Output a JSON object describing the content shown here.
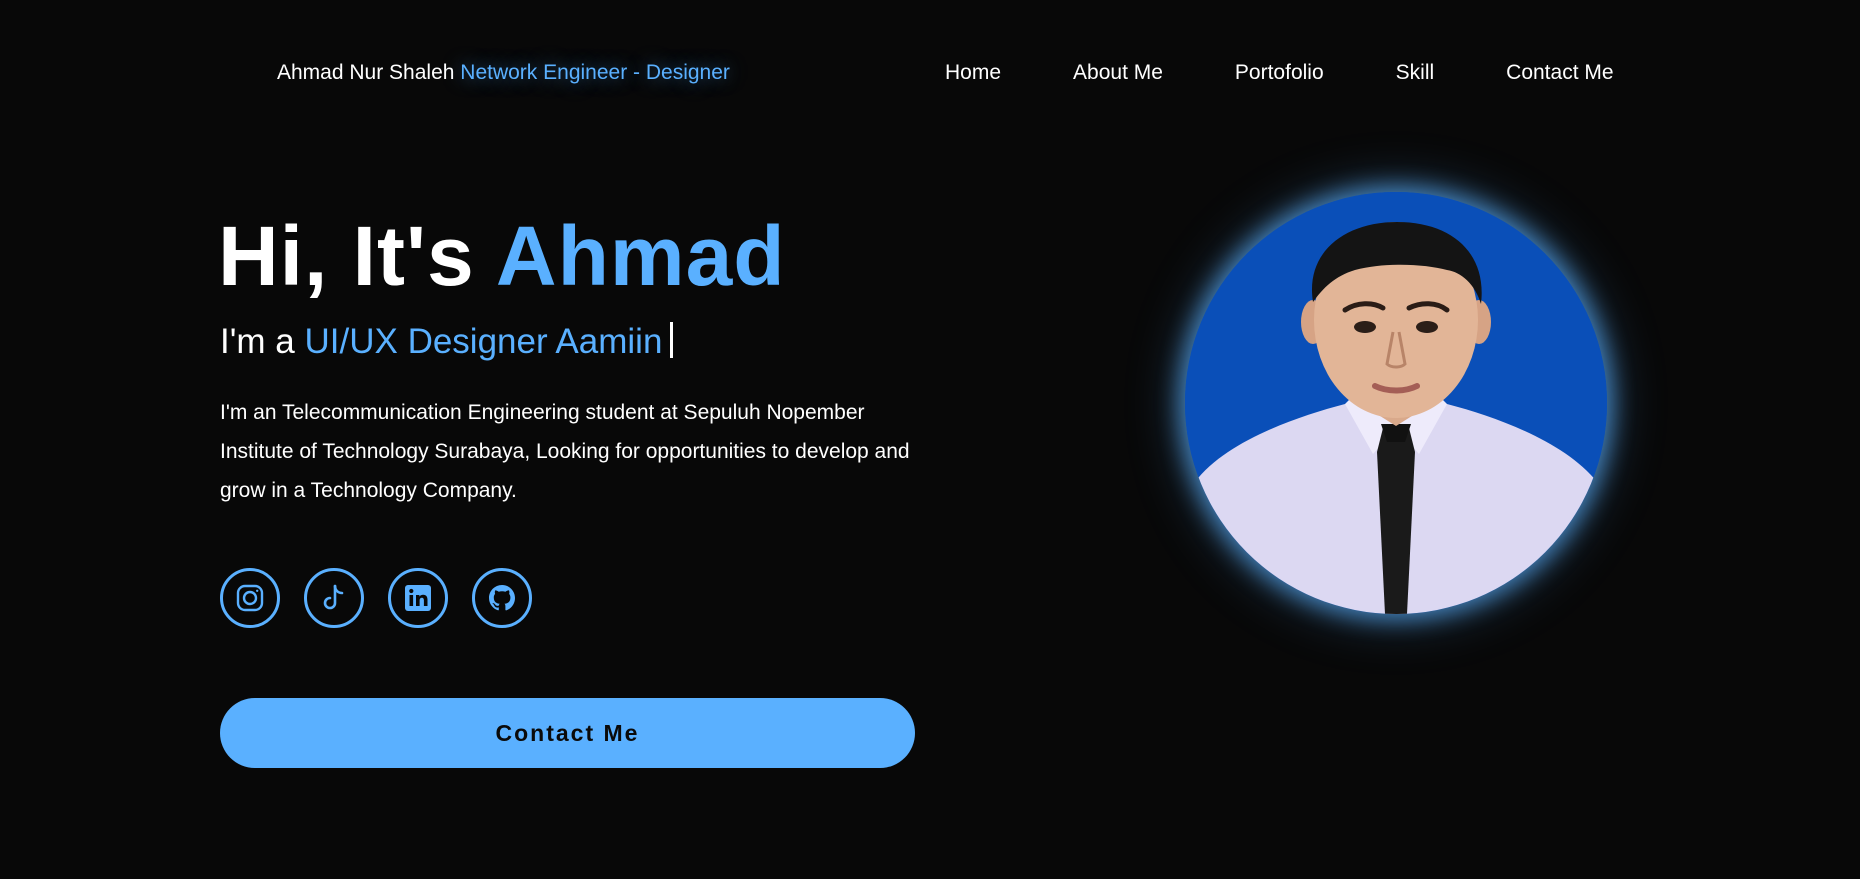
{
  "header": {
    "logo_name": "Ahmad Nur Shaleh",
    "logo_role": "Network Engineer - Designer",
    "nav": [
      {
        "label": "Home"
      },
      {
        "label": "About Me"
      },
      {
        "label": "Portofolio"
      },
      {
        "label": "Skill"
      },
      {
        "label": "Contact Me"
      }
    ]
  },
  "hero": {
    "greeting": "Hi, It's",
    "name": "Ahmad",
    "sub_prefix": "I'm a",
    "sub_typed": "UI/UX Designer Aamiin",
    "description": "I'm an Telecommunication Engineering student at Sepuluh Nopember Institute of Technology Surabaya, Looking for opportunities to develop and grow in a Technology Company.",
    "contact_button": "Contact Me"
  },
  "socials": [
    {
      "icon": "instagram-icon"
    },
    {
      "icon": "tiktok-icon"
    },
    {
      "icon": "linkedin-icon"
    },
    {
      "icon": "github-icon"
    }
  ],
  "colors": {
    "background": "#080808",
    "accent": "#5ab0ff",
    "text": "#ffffff",
    "portrait_bg": "#0a4fb8"
  }
}
